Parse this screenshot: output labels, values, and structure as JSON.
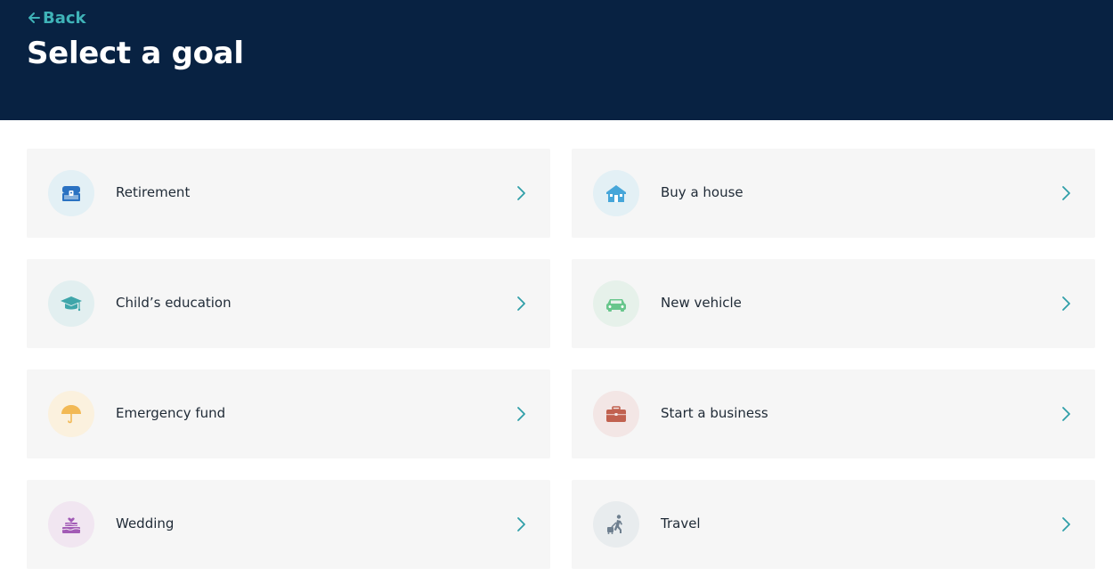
{
  "header": {
    "back_label": "Back",
    "title": "Select a goal",
    "background_color": "#082242",
    "accent_color": "#3fb3b8"
  },
  "goals": [
    {
      "label": "Retirement",
      "icon": "treasure-chest-icon",
      "icon_bg": "#e3f0f5",
      "icon_color": "#2a72c2"
    },
    {
      "label": "Buy a house",
      "icon": "house-icon",
      "icon_bg": "#e3f0f5",
      "icon_color": "#46a6d9"
    },
    {
      "label": "Child’s education",
      "icon": "graduation-cap-icon",
      "icon_bg": "#e2eff0",
      "icon_color": "#3fa6aa"
    },
    {
      "label": "New vehicle",
      "icon": "car-icon",
      "icon_bg": "#e6f1ea",
      "icon_color": "#68c68c"
    },
    {
      "label": "Emergency fund",
      "icon": "umbrella-icon",
      "icon_bg": "#fbf1de",
      "icon_color": "#f2b955"
    },
    {
      "label": "Start a business",
      "icon": "briefcase-icon",
      "icon_bg": "#f3e6e5",
      "icon_color": "#c1614f"
    },
    {
      "label": "Wedding",
      "icon": "wedding-cake-icon",
      "icon_bg": "#f1e6f1",
      "icon_color": "#a25bb5"
    },
    {
      "label": "Travel",
      "icon": "traveler-icon",
      "icon_bg": "#e8ecee",
      "icon_color": "#6e7f8f"
    }
  ]
}
